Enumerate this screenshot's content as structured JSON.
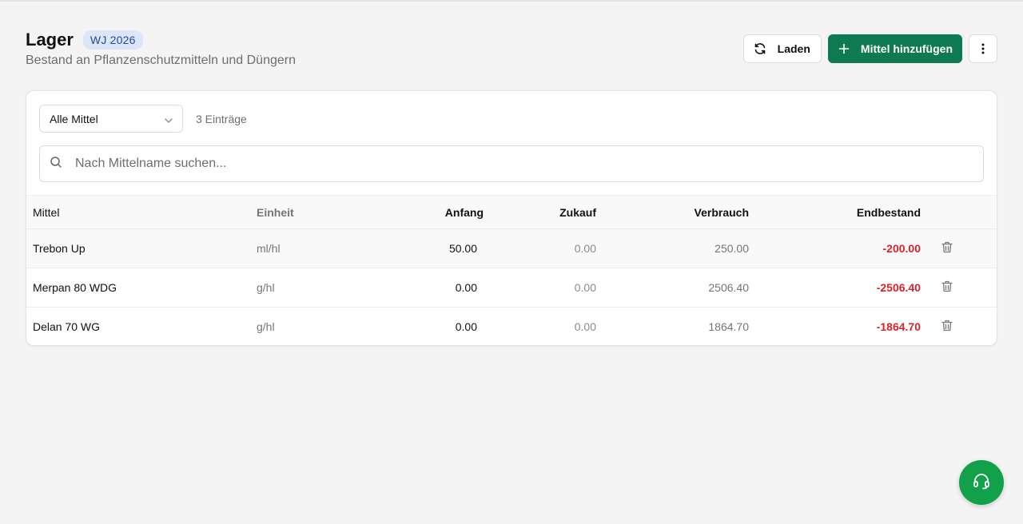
{
  "header": {
    "title": "Lager",
    "badge": "WJ 2026",
    "subtitle": "Bestand an Pflanzenschutzmitteln und Düngern"
  },
  "actions": {
    "reload_label": "Laden",
    "add_label": "Mittel hinzufügen",
    "reload_icon": "refresh-icon",
    "add_icon": "plus-icon",
    "more_icon": "more-vertical-icon"
  },
  "filter": {
    "selected": "Alle Mittel",
    "count_text": "3 Einträge"
  },
  "search": {
    "placeholder": "Nach Mittelname suchen..."
  },
  "table": {
    "headers": {
      "name": "Mittel",
      "unit": "Einheit",
      "start": "Anfang",
      "purchase": "Zukauf",
      "usage": "Verbrauch",
      "end": "Endbestand"
    },
    "rows": [
      {
        "name": "Trebon Up",
        "unit": "ml/hl",
        "start": "50.00",
        "purchase": "0.00",
        "usage": "250.00",
        "end": "-200.00"
      },
      {
        "name": "Merpan 80 WDG",
        "unit": "g/hl",
        "start": "0.00",
        "purchase": "0.00",
        "usage": "2506.40",
        "end": "-2506.40"
      },
      {
        "name": "Delan 70 WG",
        "unit": "g/hl",
        "start": "0.00",
        "purchase": "0.00",
        "usage": "1864.70",
        "end": "-1864.70"
      }
    ]
  },
  "colors": {
    "primary": "#0f7a52",
    "negative": "#d8232a",
    "fab": "#12a04a",
    "badge_bg": "#dbe6fb"
  }
}
